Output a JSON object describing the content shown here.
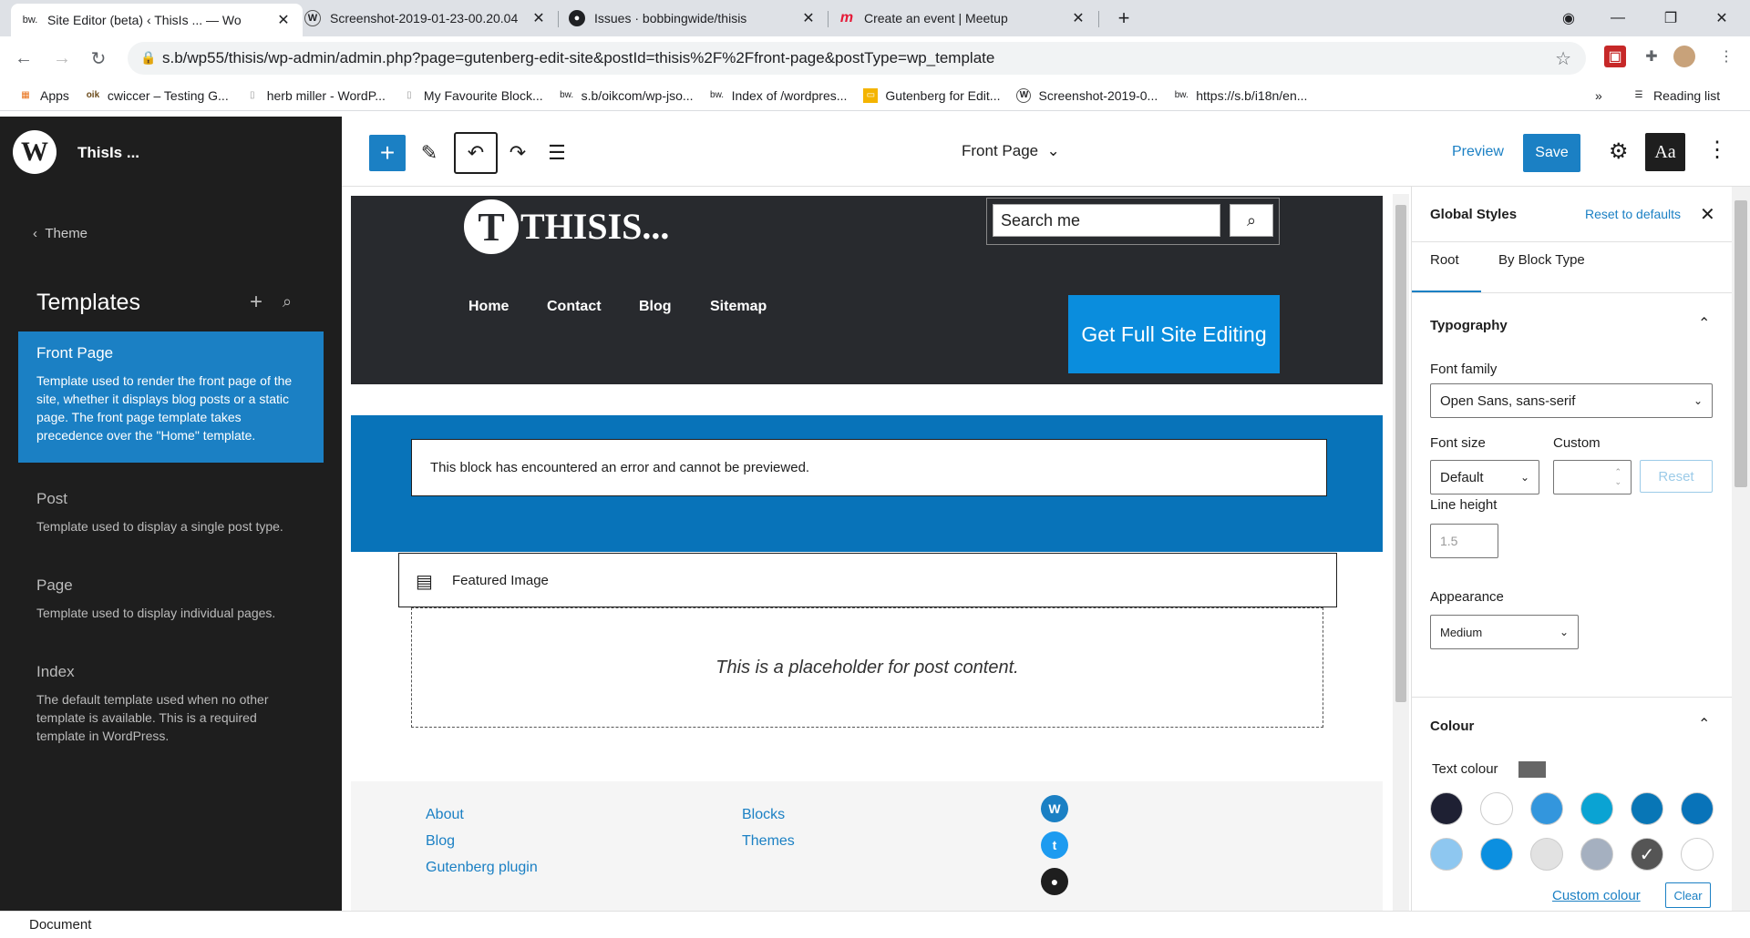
{
  "browser": {
    "tabs": [
      {
        "title": "Site Editor (beta) ‹ ThisIs ... — Wo",
        "favicon": "oik-icon"
      },
      {
        "title": "Screenshot-2019-01-23-00.20.04",
        "favicon": "wordpress-icon"
      },
      {
        "title": "Issues · bobbingwide/thisis",
        "favicon": "github-icon"
      },
      {
        "title": "Create an event | Meetup",
        "favicon": "meetup-icon"
      }
    ],
    "url": "s.b/wp55/thisis/wp-admin/admin.php?page=gutenberg-edit-site&postId=thisis%2F%2Ffront-page&postType=wp_template",
    "bookmarks": [
      {
        "label": "Apps"
      },
      {
        "label": "cwiccer – Testing G..."
      },
      {
        "label": "herb miller - WordP..."
      },
      {
        "label": "My Favourite Block..."
      },
      {
        "label": "s.b/oikcom/wp-jso..."
      },
      {
        "label": "Index of /wordpres..."
      },
      {
        "label": "Gutenberg for Edit..."
      },
      {
        "label": "Screenshot-2019-0..."
      },
      {
        "label": "https://s.b/i18n/en..."
      }
    ],
    "reading_list": "Reading list",
    "overflow": "»"
  },
  "sidebar": {
    "site_title": "ThisIs ...",
    "theme_link": "Theme",
    "templates_heading": "Templates",
    "templates": [
      {
        "title": "Front Page",
        "desc": "Template used to render the front page of the site, whether it displays blog posts or a static page. The front page template takes precedence over the \"Home\" template."
      },
      {
        "title": "Post",
        "desc": "Template used to display a single post type."
      },
      {
        "title": "Page",
        "desc": "Template used to display individual pages."
      },
      {
        "title": "Index",
        "desc": "The default template used when no other template is available. This is a required template in WordPress."
      }
    ]
  },
  "toolbar": {
    "document_title": "Front Page",
    "preview": "Preview",
    "save": "Save",
    "styles_button": "Aa"
  },
  "canvas": {
    "logo_letter": "T",
    "logo_text": "THISIS...",
    "search_placeholder": "Search me",
    "menu": [
      "Home",
      "Contact",
      "Blog",
      "Sitemap"
    ],
    "cta": "Get Full Site Editing",
    "error_message": "This block has encountered an error and cannot be previewed.",
    "featured_image": "Featured Image",
    "post_placeholder": "This is a placeholder for post content.",
    "footer_col1": [
      "About",
      "Blog",
      "Gutenberg plugin"
    ],
    "footer_col2": [
      "Blocks",
      "Themes"
    ],
    "footer_icons": [
      "wordpress-icon",
      "twitter-icon",
      "github-icon"
    ]
  },
  "global_styles": {
    "title": "Global Styles",
    "reset_defaults": "Reset to defaults",
    "tabs": [
      "Root",
      "By Block Type"
    ],
    "typography": {
      "heading": "Typography",
      "font_family_label": "Font family",
      "font_family_value": "Open Sans, sans-serif",
      "font_size_label": "Font size",
      "font_size_value": "Default",
      "custom_label": "Custom",
      "reset_label": "Reset",
      "line_height_label": "Line height",
      "line_height_placeholder": "1.5",
      "appearance_label": "Appearance",
      "appearance_value": "Medium"
    },
    "colour": {
      "heading": "Colour",
      "text_colour_label": "Text colour",
      "text_colour_value": "#666666",
      "palette": [
        "#1e2033",
        "#ffffff",
        "#3396dd",
        "#0aa3d3",
        "#0876b6",
        "#0873b9",
        "#8ec7f0",
        "#0b8fe0",
        "#e2e2e2",
        "#a5b0c0",
        "#555555",
        "#ffffff"
      ],
      "selected_index": 10,
      "custom_colour": "Custom colour",
      "clear": "Clear"
    }
  },
  "footer_bar": {
    "label": "Document"
  }
}
